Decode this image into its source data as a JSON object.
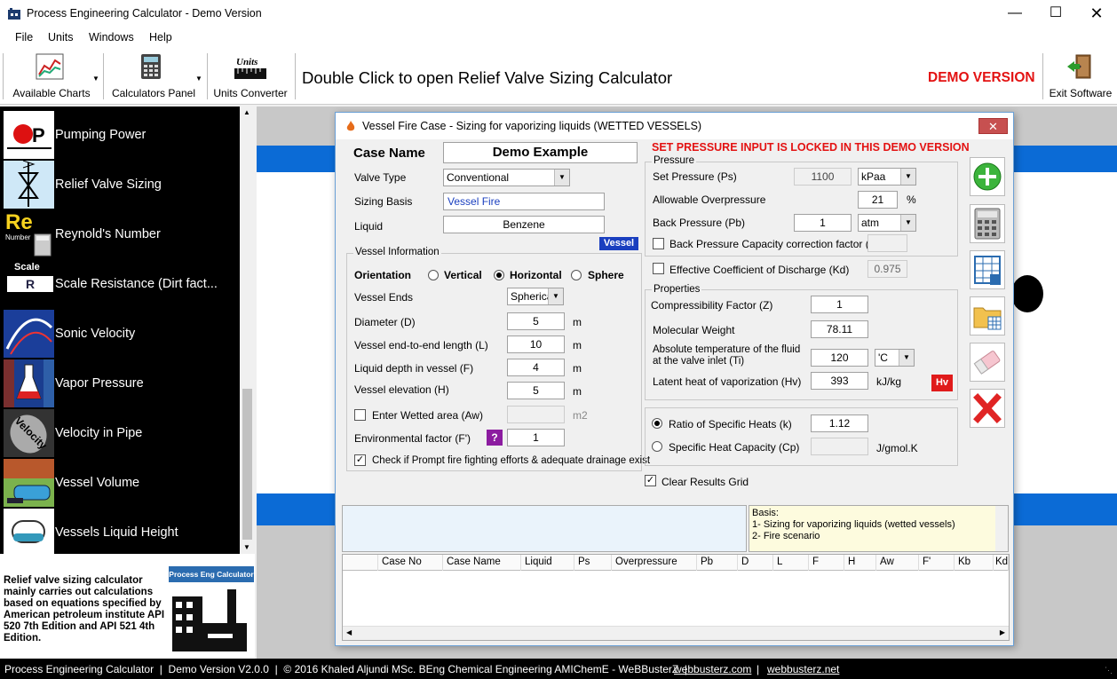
{
  "window": {
    "title": "Process Engineering Calculator - Demo Version"
  },
  "menu": [
    "File",
    "Units",
    "Windows",
    "Help"
  ],
  "toolbar": {
    "available_charts": "Available Charts",
    "calculators_panel": "Calculators Panel",
    "units_converter": "Units Converter",
    "units_icon_text": "Units",
    "hint": "Double Click to open Relief Valve Sizing Calculator",
    "demo": "DEMO VERSION",
    "exit": "Exit Software",
    "demo_color": "#e31212"
  },
  "sidebar": {
    "items": [
      {
        "label": "Pumping Power",
        "icon": "pump-icon"
      },
      {
        "label": "Relief Valve Sizing",
        "icon": "relief-valve-icon"
      },
      {
        "label": "Reynold's Number",
        "icon": "reynolds-number-icon",
        "icon_text": "Re",
        "icon_sub": "Number"
      },
      {
        "label": "Scale Resistance (Dirt fact...",
        "icon": "scale-resistance-icon",
        "icon_text": "Scale",
        "icon_sub": "R"
      },
      {
        "label": "Sonic Velocity",
        "icon": "sonic-velocity-icon"
      },
      {
        "label": "Vapor Pressure",
        "icon": "vapor-pressure-icon"
      },
      {
        "label": "Velocity in Pipe",
        "icon": "velocity-pipe-icon",
        "icon_text": "Velocity"
      },
      {
        "label": "Vessel Volume",
        "icon": "vessel-volume-icon"
      },
      {
        "label": "Vessels Liquid Height",
        "icon": "vessel-height-icon"
      }
    ],
    "info": "Relief valve sizing calculator mainly carries out calculations based on equations specified by American petroleum institute API 520 7th Edition and API 521 4th Edition.",
    "logo_text": "Process Eng Calculator"
  },
  "dialog": {
    "title": "Vessel Fire Case - Sizing for vaporizing liquids (WETTED VESSELS)",
    "case_name_label": "Case Name",
    "case_name": "Demo Example",
    "locked": "SET PRESSURE INPUT IS LOCKED IN THIS DEMO VERSION",
    "valve_type_label": "Valve Type",
    "valve_type": "Conventional",
    "sizing_basis_label": "Sizing Basis",
    "sizing_basis": "Vessel Fire",
    "liquid_label": "Liquid",
    "liquid": "Benzene",
    "vessel_badge": "Vessel",
    "vessel_info": {
      "title": "Vessel Information",
      "orientation_label": "Orientation",
      "vertical": "Vertical",
      "horizontal": "Horizontal",
      "sphere": "Sphere",
      "ends_label": "Vessel Ends",
      "ends": "Spherical",
      "diameter_label": "Diameter (D)",
      "diameter": "5",
      "diameter_unit": "m",
      "length_label": "Vessel end-to-end length (L)",
      "length": "10",
      "length_unit": "m",
      "depth_label": "Liquid depth in vessel (F)",
      "depth": "4",
      "depth_unit": "m",
      "elev_label": "Vessel elevation (H)",
      "elev": "5",
      "elev_unit": "m",
      "wetted_label": "Enter Wetted area (Aw)",
      "wetted_unit": "m2",
      "env_label": "Environmental factor (F')",
      "env": "1",
      "help": "?",
      "prompt_label": "Check if Prompt fire fighting efforts & adequate drainage exist"
    },
    "pressure": {
      "title": "Pressure",
      "set_label": "Set Pressure (Ps)",
      "set": "1100",
      "set_unit": "kPaa",
      "overp_label": "Allowable Overpressure",
      "overp": "21",
      "overp_unit": "%",
      "back_label": "Back Pressure (Pb)",
      "back": "1",
      "back_unit": "atm",
      "kb_label": "Back Pressure Capacity correction factor (Kb)"
    },
    "kd_label": "Effective Coefficient of Discharge (Kd)",
    "kd": "0.975",
    "properties": {
      "title": "Properties",
      "z_label": "Compressibility Factor (Z)",
      "z": "1",
      "mw_label": "Molecular Weight",
      "mw": "78.11",
      "temp_label1": "Absolute temperature of the fluid",
      "temp_label2": "at the valve inlet (Ti)",
      "temp": "120",
      "temp_unit": "'C",
      "hv_label": "Latent heat of vaporization (Hv)",
      "hv": "393",
      "hv_unit": "kJ/kg",
      "hv_btn": "Hv"
    },
    "heat": {
      "k_label": "Ratio of Specific Heats (k)",
      "k": "1.12",
      "cp_label": "Specific Heat Capacity (Cp)",
      "cp_unit": "J/gmol.K"
    },
    "clear_label": "Clear Results Grid",
    "basis": {
      "title": "Basis:",
      "l1": "1- Sizing for vaporizing liquids (wetted vessels)",
      "l2": "2- Fire scenario"
    },
    "grid_cols": [
      "Case No",
      "Case Name",
      "Liquid",
      "Ps",
      "Overpressure",
      "Pb",
      "D",
      "L",
      "F",
      "H",
      "Aw",
      "F'",
      "Kb",
      "Kd"
    ]
  },
  "status": {
    "text": "Process Engineering Calculator  |  Demo Version V2.0.0  |  © 2016 Khaled Aljundi MSc. BEng Chemical Engineering AMIChemE - WeBBusterZ  |",
    "link1": "webbusterz.com",
    "sep": "|",
    "link2": "webbusterz.net"
  }
}
